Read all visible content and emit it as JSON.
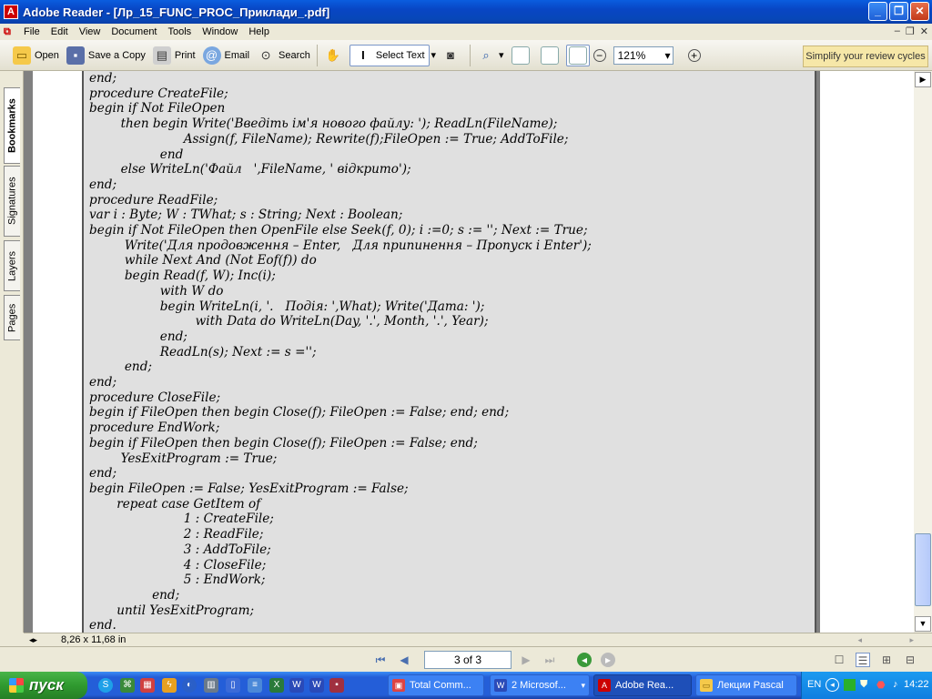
{
  "window": {
    "title": "Adobe Reader - [Лр_15_FUNC_PROC_Приклади_.pdf]",
    "app_icon": "adobe-reader-icon",
    "buttons": {
      "minimize": "_",
      "maximize": "❐",
      "close": "✕"
    }
  },
  "menu": {
    "items": [
      "File",
      "Edit",
      "View",
      "Document",
      "Tools",
      "Window",
      "Help"
    ],
    "doc_controls": {
      "minimize": "–",
      "restore": "❐",
      "close": "✕"
    }
  },
  "toolbar": {
    "open": "Open",
    "save_copy": "Save a Copy",
    "print": "Print",
    "email": "Email",
    "search": "Search",
    "select_text": "Select Text",
    "zoom_value": "121%",
    "promo": "Simplify your review cycles"
  },
  "nav_tabs": [
    "Bookmarks",
    "Signatures",
    "Layers",
    "Pages"
  ],
  "document": {
    "lines": [
      "end;",
      "procedure CreateFile;",
      "begin if Not FileOpen",
      "        then begin Write('Введіть ім'я нового файлу: '); ReadLn(FileName);",
      "                        Assign(f, FileName); Rewrite(f);FileOpen := True; AddToFile;",
      "                  end",
      "        else WriteLn('Файл   ',FileName, ' відкрито');",
      "end;",
      "procedure ReadFile;",
      "var i : Byte; W : TWhat; s : String; Next : Boolean;",
      "begin if Not FileOpen then OpenFile else Seek(f, 0); i :=0; s := ''; Next := True;",
      "         Write('Для продовження – Enter,   Для припинення – Пропуск і Enter');",
      "         while Next And (Not Eof(f)) do",
      "         begin Read(f, W); Inc(i);",
      "                  with W do",
      "                  begin WriteLn(i, '.   Подія: ',What); Write('Дата: ');",
      "                           with Data do WriteLn(Day, '.', Month, '.', Year);",
      "                  end;",
      "                  ReadLn(s); Next := s ='';",
      "         end;",
      "end;",
      "procedure CloseFile;",
      "begin if FileOpen then begin Close(f); FileOpen := False; end; end;",
      "procedure EndWork;",
      "begin if FileOpen then begin Close(f); FileOpen := False; end;",
      "        YesExitProgram := True;",
      "end;",
      "begin FileOpen := False; YesExitProgram := False;",
      "       repeat case GetItem of",
      "                        1 : CreateFile;",
      "                        2 : ReadFile;",
      "                        3 : AddToFile;",
      "                        4 : CloseFile;",
      "                        5 : EndWork;",
      "                end;",
      "       until YesExitProgram;",
      "end."
    ]
  },
  "status": {
    "page_size": "8,26 x 11,68 in"
  },
  "navigation": {
    "page_indicator": "3 of 3"
  },
  "taskbar": {
    "start_label": "пуск",
    "tasks": [
      {
        "label": "Total Comm...",
        "icon": "total-commander-icon",
        "active": false
      },
      {
        "label": "2 Microsof...",
        "icon": "word-icon",
        "active": false
      },
      {
        "label": "Adobe Rea...",
        "icon": "adobe-reader-icon",
        "active": true
      },
      {
        "label": "Лекции Pascal",
        "icon": "folder-icon",
        "active": false
      }
    ],
    "language": "EN",
    "clock": "14:22"
  }
}
